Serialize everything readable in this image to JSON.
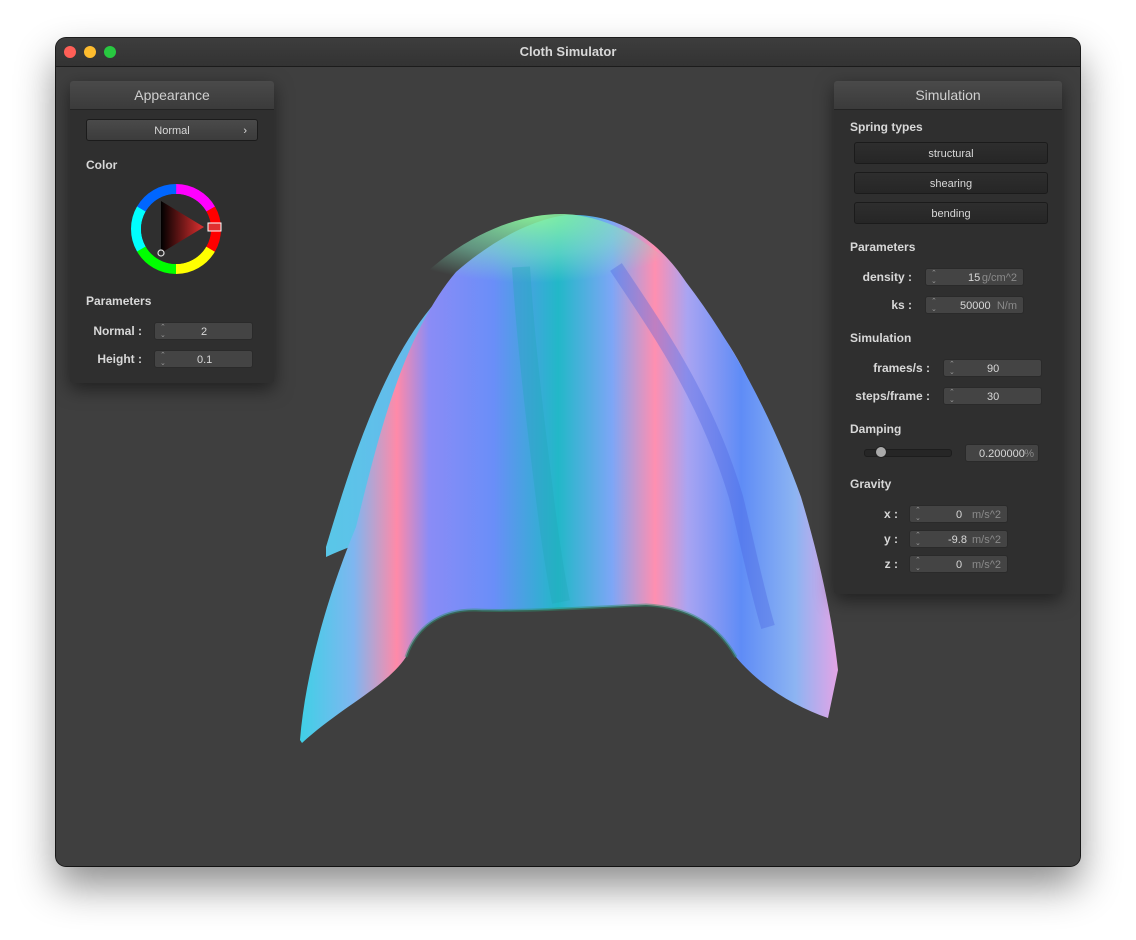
{
  "window": {
    "title": "Cloth Simulator"
  },
  "appearance": {
    "header": "Appearance",
    "shader_select": "Normal",
    "shader_arrow": "›",
    "color_label": "Color",
    "params_label": "Parameters",
    "normal_label": "Normal :",
    "normal_value": "2",
    "height_label": "Height :",
    "height_value": "0.1"
  },
  "simulation": {
    "header": "Simulation",
    "spring_types_label": "Spring types",
    "structural": "structural",
    "shearing": "shearing",
    "bending": "bending",
    "parameters_label": "Parameters",
    "density_label": "density :",
    "density_value": "15",
    "density_unit": "g/cm^2",
    "ks_label": "ks :",
    "ks_value": "50000",
    "ks_unit": "N/m",
    "sim_label": "Simulation",
    "fps_label": "frames/s :",
    "fps_value": "90",
    "steps_label": "steps/frame :",
    "steps_value": "30",
    "damping_label": "Damping",
    "damping_value": "0.200000",
    "damping_unit": "%",
    "gravity_label": "Gravity",
    "gx_label": "x :",
    "gx_value": "0",
    "gy_label": "y :",
    "gy_value": "-9.8",
    "gz_label": "z :",
    "gz_value": "0",
    "g_unit": "m/s^2"
  },
  "colors": {
    "close": "#ff5f57",
    "minimize": "#febc2e",
    "maximize": "#28c840",
    "selected_color": "#e03030"
  }
}
